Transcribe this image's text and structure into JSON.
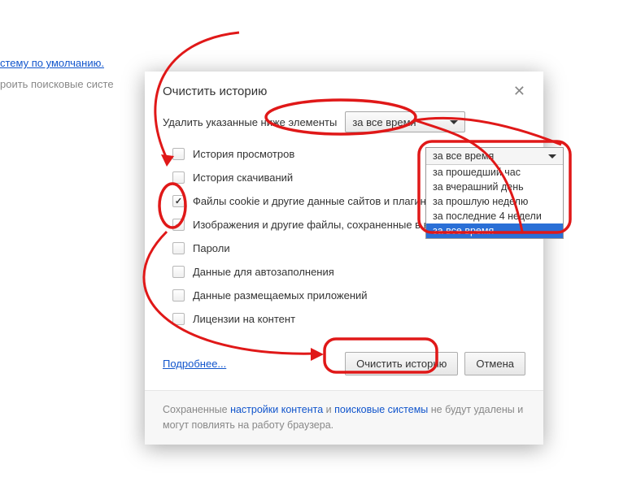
{
  "background": {
    "link1": "стему по умолчанию.",
    "text1": "роить поисковые систе"
  },
  "dialog": {
    "title": "Очистить историю",
    "prompt": "Удалить указанные ниже элементы",
    "time_select": "за все время",
    "items": [
      {
        "label": "История просмотров",
        "checked": false
      },
      {
        "label": "История скачиваний",
        "checked": false
      },
      {
        "label": "Файлы cookie и другие данные сайтов и плагинов",
        "checked": true
      },
      {
        "label": "Изображения и другие файлы, сохраненные в кеше",
        "checked": true
      },
      {
        "label": "Пароли",
        "checked": false
      },
      {
        "label": "Данные для автозаполнения",
        "checked": false
      },
      {
        "label": "Данные размещаемых приложений",
        "checked": false
      },
      {
        "label": "Лицензии на контент",
        "checked": false
      }
    ],
    "more": "Подробнее...",
    "clear": "Очистить историю",
    "cancel": "Отмена",
    "footer_pre": "Сохраненные ",
    "footer_link1": "настройки контента",
    "footer_mid": " и ",
    "footer_link2": "поисковые системы",
    "footer_post": " не будут удалены и могут повлиять на работу браузера."
  },
  "popup": {
    "selected": "за все время",
    "options": [
      "за прошедший час",
      "за вчерашний день",
      "за прошлую неделю",
      "за последние 4 недели",
      "за все время"
    ],
    "highlight_index": 4
  }
}
